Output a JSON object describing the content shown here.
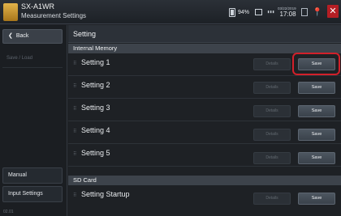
{
  "header": {
    "model": "SX-A1WR",
    "subtitle": "Measurement Settings",
    "battery": "94%",
    "rec_indicator": "▮▮▮",
    "date": "03/22/2019",
    "time": "17:08",
    "close_label": "✕"
  },
  "sidebar": {
    "back_label": "Back",
    "back_arrow": "❮",
    "save_load_label": "Save / Load",
    "manual_label": "Manual",
    "input_settings_label": "Input Settings",
    "version": "02.01"
  },
  "main": {
    "title": "Setting",
    "internal_memory_label": "Internal Memory",
    "sd_card_label": "SD Card",
    "row_icon": "⠿",
    "details_label": "Details",
    "save_label": "Save",
    "internal_settings": [
      {
        "label": "Setting 1"
      },
      {
        "label": "Setting 2"
      },
      {
        "label": "Setting 3"
      },
      {
        "label": "Setting 4"
      },
      {
        "label": "Setting 5"
      }
    ],
    "sd_settings": [
      {
        "label": "Setting Startup"
      }
    ]
  },
  "colors": {
    "accent_highlight": "#d2202a",
    "close_red": "#b51e24",
    "logo_gold": "#e2b34a",
    "pin_yellow": "#e8b21c"
  }
}
